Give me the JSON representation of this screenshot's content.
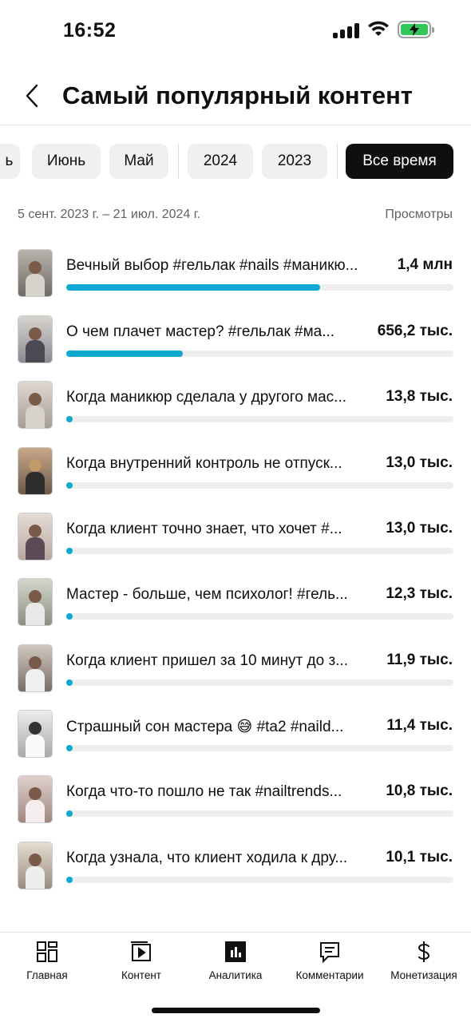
{
  "status_bar": {
    "time": "16:52",
    "icons": [
      "signal-icon",
      "wifi-icon",
      "battery-charging-icon"
    ],
    "battery_color": "#33c759"
  },
  "header": {
    "title": "Самый популярный контент",
    "back_icon": "chevron-left-icon"
  },
  "filters": {
    "chips": [
      {
        "label": "ь",
        "active": false
      },
      {
        "label": "Июнь",
        "active": false
      },
      {
        "label": "Май",
        "active": false
      },
      {
        "label": "2024",
        "active": false
      },
      {
        "label": "2023",
        "active": false
      },
      {
        "label": "Все время",
        "active": true
      }
    ]
  },
  "range": {
    "dates": "5 сент. 2023 г. – 21 июл. 2024 г.",
    "metric": "Просмотры"
  },
  "accent_color": "#0fa8d0",
  "items": [
    {
      "title": "Вечный выбор #гельлак #nails #маникю...",
      "value": "1,4 млн",
      "share": 0.655
    },
    {
      "title": "О чем плачет мастер? #гельлак #ма...",
      "value": "656,2 тыс.",
      "share": 0.3
    },
    {
      "title": "Когда маникюр сделала у другого мас...",
      "value": "13,8 тыс.",
      "share": 0.01
    },
    {
      "title": "Когда внутренний контроль не отпуск...",
      "value": "13,0 тыс.",
      "share": 0.01
    },
    {
      "title": "Когда клиент точно знает, что хочет #...",
      "value": "13,0 тыс.",
      "share": 0.01
    },
    {
      "title": "Мастер - больше, чем психолог! #гель...",
      "value": "12,3 тыс.",
      "share": 0.01
    },
    {
      "title": "Когда клиент пришел за 10 минут до з...",
      "value": "11,9 тыс.",
      "share": 0.01
    },
    {
      "title": "Страшный сон мастера 😅 #ta2 #naild...",
      "value": "11,4 тыс.",
      "share": 0.01
    },
    {
      "title": "Когда что-то пошло не так #nailtrends...",
      "value": "10,8 тыс.",
      "share": 0.01
    },
    {
      "title": "Когда узнала, что клиент ходила к дру...",
      "value": "10,1 тыс.",
      "share": 0.01
    }
  ],
  "bottom_nav": [
    {
      "label": "Главная",
      "icon": "home-grid-icon"
    },
    {
      "label": "Контент",
      "icon": "content-play-icon"
    },
    {
      "label": "Аналитика",
      "icon": "analytics-chart-icon"
    },
    {
      "label": "Комментарии",
      "icon": "comments-icon"
    },
    {
      "label": "Монетизация",
      "icon": "dollar-icon"
    }
  ]
}
